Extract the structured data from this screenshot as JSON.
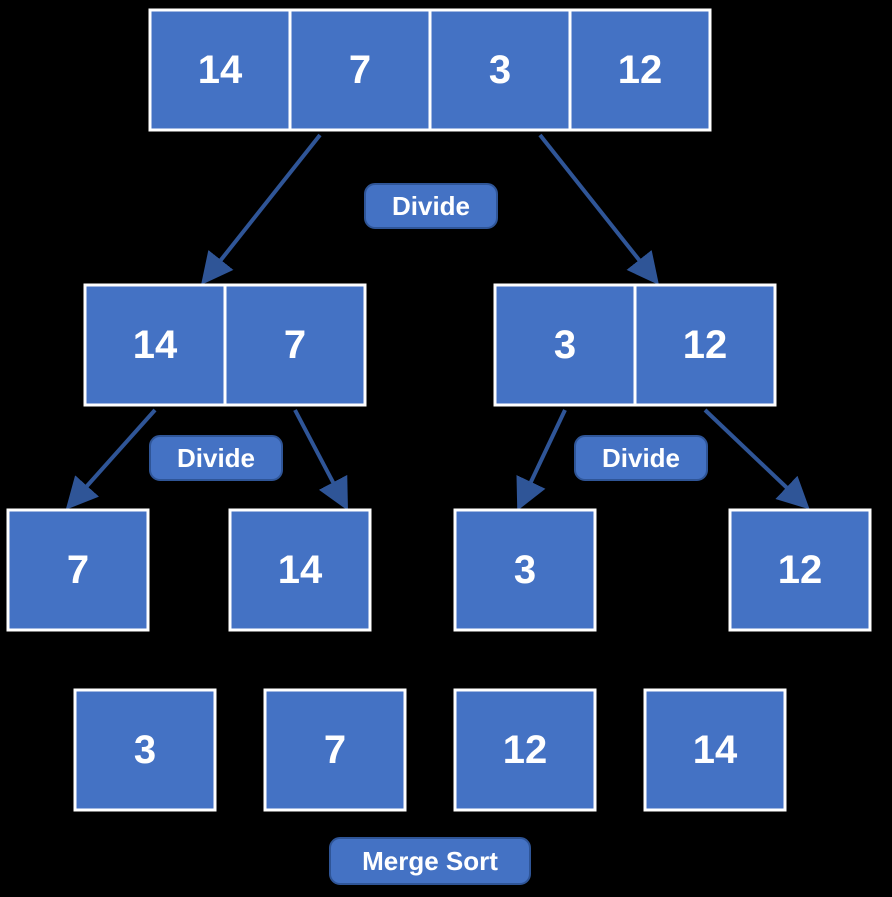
{
  "row1": {
    "a": "14",
    "b": "7",
    "c": "3",
    "d": "12"
  },
  "row2": {
    "left_a": "14",
    "left_b": "7",
    "right_a": "3",
    "right_b": "12"
  },
  "row3": {
    "a": "7",
    "b": "14",
    "c": "3",
    "d": "12"
  },
  "row4": {
    "a": "3",
    "b": "7",
    "c": "12",
    "d": "14"
  },
  "labels": {
    "divide1": "Divide",
    "divide2": "Divide",
    "divide3": "Divide",
    "merge": "Merge Sort"
  },
  "chart_data": {
    "type": "diagram",
    "algorithm": "Merge Sort",
    "initial_array": [
      14,
      7,
      3,
      12
    ],
    "steps": [
      {
        "op": "divide",
        "result": [
          [
            14,
            7
          ],
          [
            3,
            12
          ]
        ]
      },
      {
        "op": "divide",
        "result": [
          [
            7
          ],
          [
            14
          ],
          [
            3
          ],
          [
            12
          ]
        ]
      },
      {
        "op": "merge",
        "result": [
          3,
          7,
          12,
          14
        ]
      }
    ],
    "sorted_array": [
      3,
      7,
      12,
      14
    ]
  }
}
